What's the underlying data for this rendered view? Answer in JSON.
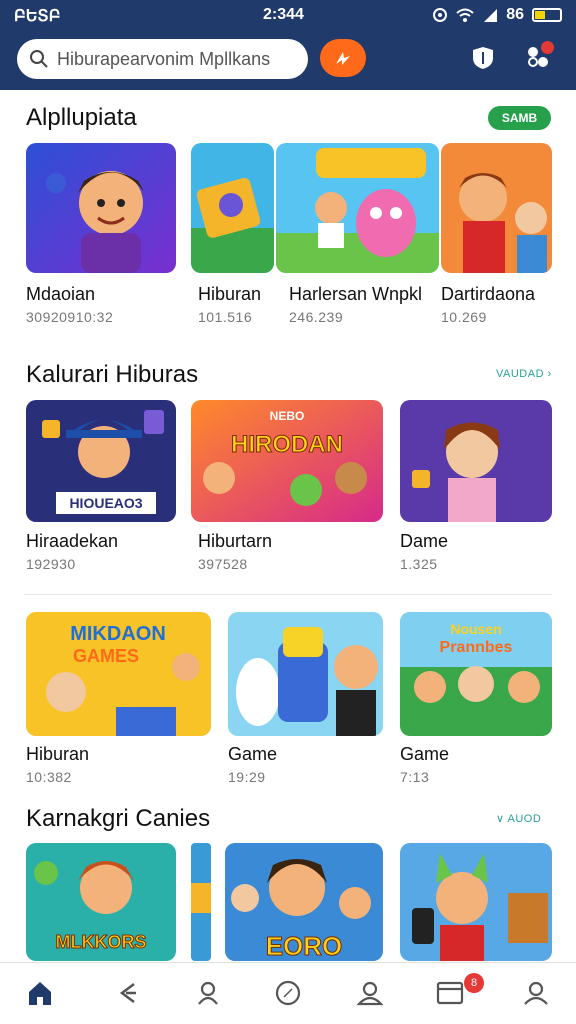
{
  "status_bar": {
    "left": "ԲԵՏԲ",
    "clock": "2:344",
    "battery_text": "86",
    "battery_level": 0.4
  },
  "header": {
    "search_placeholder": "Hiburapearvonim Mpllkans",
    "menu_badge": ""
  },
  "section1": {
    "title": "Alpllupiata",
    "pill": "SAMB",
    "items": [
      {
        "title": "Mdaoian",
        "sub": "30920910:32"
      },
      {
        "title": "Hiburan",
        "sub": "101.516"
      },
      {
        "title": "Harlersan Wnpkl",
        "sub": "246.239"
      },
      {
        "title": "Dartirdaona",
        "sub": "10.269"
      }
    ]
  },
  "section2": {
    "title": "Kalurari Hiburas",
    "see_more": "VAUDAD ›",
    "items": [
      {
        "title": "Hiraadekan",
        "sub": "192930",
        "art_text": "HIOUEAO3"
      },
      {
        "title": "Hiburtarn",
        "sub": "397528",
        "art_text": "HIRODAN",
        "art_sub": "NEBO"
      },
      {
        "title": "Dame",
        "sub": "1.325"
      }
    ]
  },
  "section3": {
    "items": [
      {
        "title": "Hiburan",
        "sub": "10:382",
        "art_text": "MIKDAON",
        "art_sub": "GAMES"
      },
      {
        "title": "Game",
        "sub": "19:29"
      },
      {
        "title": "Game",
        "sub": "7:13",
        "art_text": "Nousen",
        "art_sub": "Prannbes"
      }
    ]
  },
  "section4": {
    "title": "Karnakgri Canies",
    "see_more": "∨ AUOD",
    "items": [
      {
        "art_text": "MLKKORS"
      },
      {
        "art_text": "EORO"
      },
      {
        "art_text": ""
      }
    ]
  },
  "bottom_nav": {
    "badge": "8"
  },
  "colors": {
    "header_bg": "#1f3a6b",
    "accent_orange": "#ff6a1a",
    "pill_green": "#26a04a",
    "see_more": "#2aa198",
    "nav_active": "#1f3a6b"
  }
}
